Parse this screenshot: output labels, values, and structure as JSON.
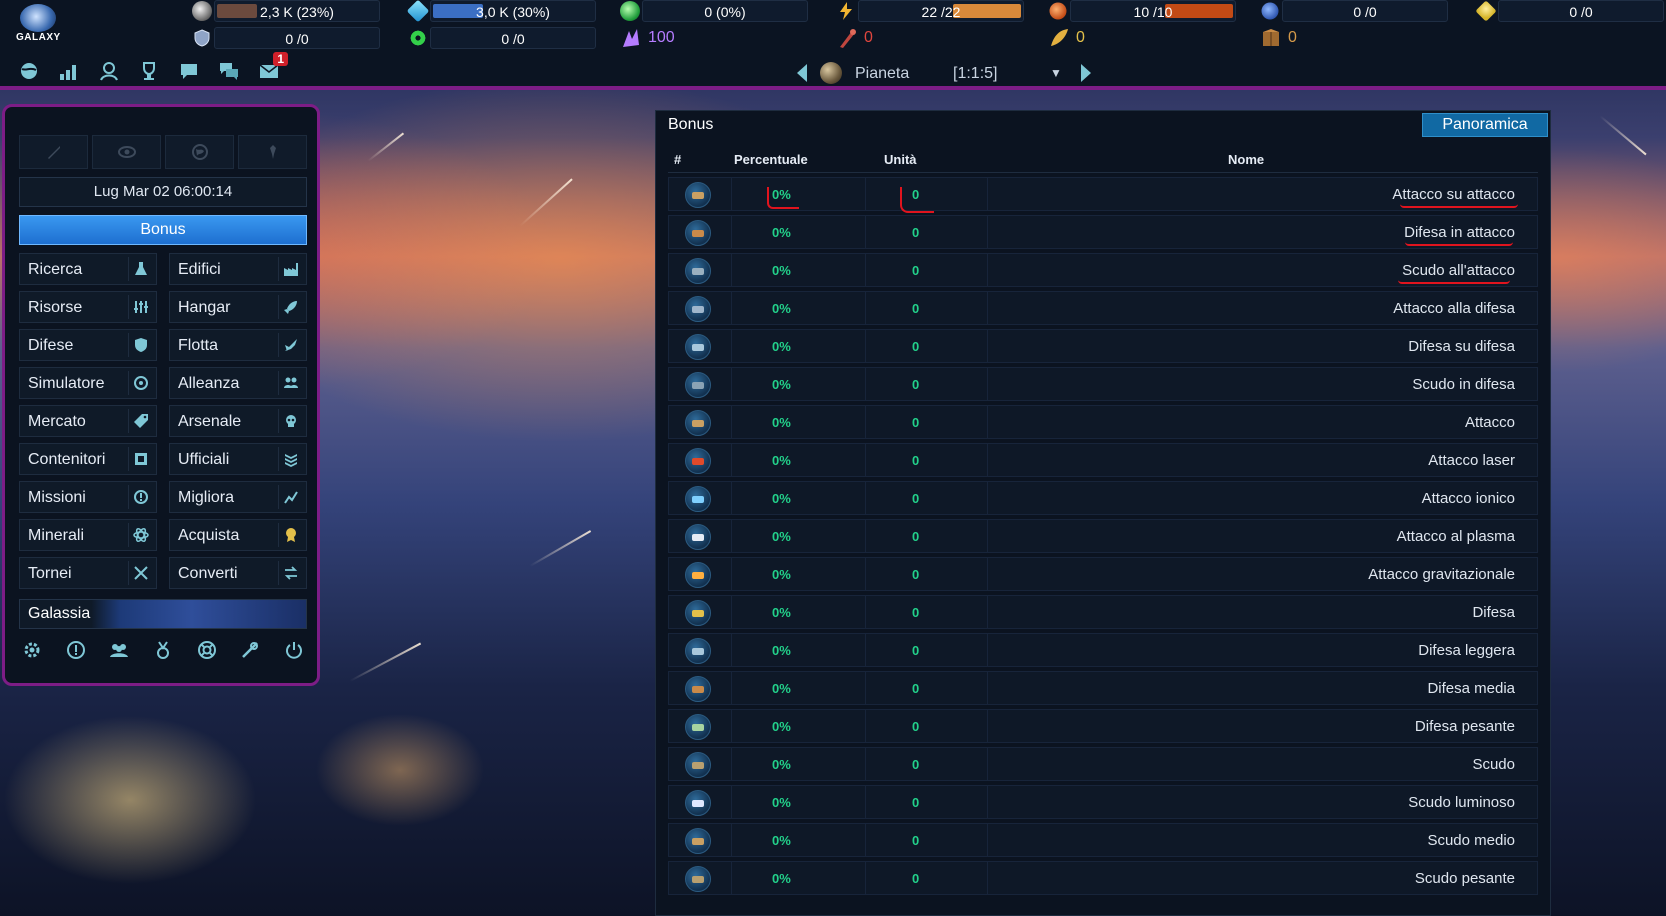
{
  "logo": {
    "text": "GALAXY"
  },
  "resources_row1": [
    {
      "icon": "metal-icon",
      "value": "2,3 K (23%)",
      "fill": 0.23,
      "color": "#6b4a3e"
    },
    {
      "icon": "crystal-icon",
      "value": "3,0 K (30%)",
      "fill": 0.3,
      "color": "#3b6fc4"
    },
    {
      "icon": "deuterium-icon",
      "value": "0 (0%)",
      "fill": 0.0,
      "color": "#2fb25a"
    },
    {
      "icon": "energy-icon",
      "value": "22 /22",
      "fill": 1.0,
      "color": "#d8893a"
    },
    {
      "icon": "orange-resource-icon",
      "value": "10 /10",
      "fill": 1.0,
      "color": "#c24a15"
    },
    {
      "icon": "blue-resource-icon",
      "value": "0 /0",
      "fill": 0.0,
      "color": "#3b6fc4"
    },
    {
      "icon": "yellow-resource-icon",
      "value": "0 /0",
      "fill": 0.0,
      "color": "#d6b52a"
    }
  ],
  "resources_row2": [
    {
      "icon": "shield-resource-icon",
      "value": "0 /0"
    },
    {
      "icon": "radiation-icon",
      "value": "0 /0"
    }
  ],
  "special_resources": [
    {
      "icon": "crystal-shard-icon",
      "value": "100",
      "color": "#b57cff"
    },
    {
      "icon": "missile-icon",
      "value": "0",
      "color": "#e0463e"
    },
    {
      "icon": "gold-feather-icon",
      "value": "0",
      "color": "#e3c04a"
    },
    {
      "icon": "crate-icon",
      "value": "0",
      "color": "#d59a4a"
    }
  ],
  "nav": {
    "messages_badge": "1"
  },
  "planet_selector": {
    "name": "Pianeta",
    "coords": "[1:1:5]"
  },
  "left_panel": {
    "datetime": "Lug Mar 02 06:00:14",
    "bonus_button": "Bonus",
    "menu": [
      {
        "label": "Ricerca",
        "icon": "flask-icon"
      },
      {
        "label": "Edifici",
        "icon": "factory-icon"
      },
      {
        "label": "Risorse",
        "icon": "sliders-icon"
      },
      {
        "label": "Hangar",
        "icon": "rocket-icon"
      },
      {
        "label": "Difese",
        "icon": "shield-icon"
      },
      {
        "label": "Flotta",
        "icon": "fleet-icon"
      },
      {
        "label": "Simulatore",
        "icon": "crosshair-icon"
      },
      {
        "label": "Alleanza",
        "icon": "group-icon"
      },
      {
        "label": "Mercato",
        "icon": "tag-icon"
      },
      {
        "label": "Arsenale",
        "icon": "skull-icon"
      },
      {
        "label": "Contenitori",
        "icon": "container-icon"
      },
      {
        "label": "Ufficiali",
        "icon": "rank-icon"
      },
      {
        "label": "Missioni",
        "icon": "mission-icon"
      },
      {
        "label": "Migliora",
        "icon": "upgrade-icon"
      },
      {
        "label": "Minerali",
        "icon": "atom-icon"
      },
      {
        "label": "Acquista",
        "icon": "medal-icon"
      },
      {
        "label": "Tornei",
        "icon": "swords-icon"
      },
      {
        "label": "Converti",
        "icon": "swap-icon"
      }
    ],
    "galaxy_button": "Galassia"
  },
  "bonus_panel": {
    "title": "Bonus",
    "overview_button": "Panoramica",
    "columns": {
      "hash": "#",
      "percent": "Percentuale",
      "units": "Unità",
      "name": "Nome"
    },
    "rows": [
      {
        "icon": "gun-icon",
        "percent": "0%",
        "units": "0",
        "name": "Attacco su attacco",
        "color": "#c9a063"
      },
      {
        "icon": "armor-icon",
        "percent": "0%",
        "units": "0",
        "name": "Difesa in attacco",
        "color": "#c98a4a"
      },
      {
        "icon": "ship-shield-icon",
        "percent": "0%",
        "units": "0",
        "name": "Scudo all'attacco",
        "color": "#9ab0c0"
      },
      {
        "icon": "blaster-icon",
        "percent": "0%",
        "units": "0",
        "name": "Attacco alla difesa",
        "color": "#9fb6cc"
      },
      {
        "icon": "plate-icon",
        "percent": "0%",
        "units": "0",
        "name": "Difesa su difesa",
        "color": "#a9c8dc"
      },
      {
        "icon": "saucer-icon",
        "percent": "0%",
        "units": "0",
        "name": "Scudo in difesa",
        "color": "#8aa3b5"
      },
      {
        "icon": "rifle-icon",
        "percent": "0%",
        "units": "0",
        "name": "Attacco",
        "color": "#c9a063"
      },
      {
        "icon": "laser-icon",
        "percent": "0%",
        "units": "0",
        "name": "Attacco laser",
        "color": "#e04a2a"
      },
      {
        "icon": "ion-icon",
        "percent": "0%",
        "units": "0",
        "name": "Attacco ionico",
        "color": "#7fd0ff"
      },
      {
        "icon": "plasma-icon",
        "percent": "0%",
        "units": "0",
        "name": "Attacco al plasma",
        "color": "#e6ecf5"
      },
      {
        "icon": "gravity-icon",
        "percent": "0%",
        "units": "0",
        "name": "Attacco gravitazionale",
        "color": "#ffb040"
      },
      {
        "icon": "gold-plate-icon",
        "percent": "0%",
        "units": "0",
        "name": "Difesa",
        "color": "#e3c04a"
      },
      {
        "icon": "light-plate-icon",
        "percent": "0%",
        "units": "0",
        "name": "Difesa leggera",
        "color": "#a9c8dc"
      },
      {
        "icon": "bronze-plate-icon",
        "percent": "0%",
        "units": "0",
        "name": "Difesa media",
        "color": "#c98a4a"
      },
      {
        "icon": "green-plate-icon",
        "percent": "0%",
        "units": "0",
        "name": "Difesa pesante",
        "color": "#a8d4a0"
      },
      {
        "icon": "shield-ship-icon",
        "percent": "0%",
        "units": "0",
        "name": "Scudo",
        "color": "#b8a070"
      },
      {
        "icon": "glow-shield-icon",
        "percent": "0%",
        "units": "0",
        "name": "Scudo luminoso",
        "color": "#dfe8ff"
      },
      {
        "icon": "mid-shield-icon",
        "percent": "0%",
        "units": "0",
        "name": "Scudo medio",
        "color": "#c9a063"
      },
      {
        "icon": "heavy-shield-icon",
        "percent": "0%",
        "units": "0",
        "name": "Scudo pesante",
        "color": "#b8a070"
      }
    ]
  }
}
